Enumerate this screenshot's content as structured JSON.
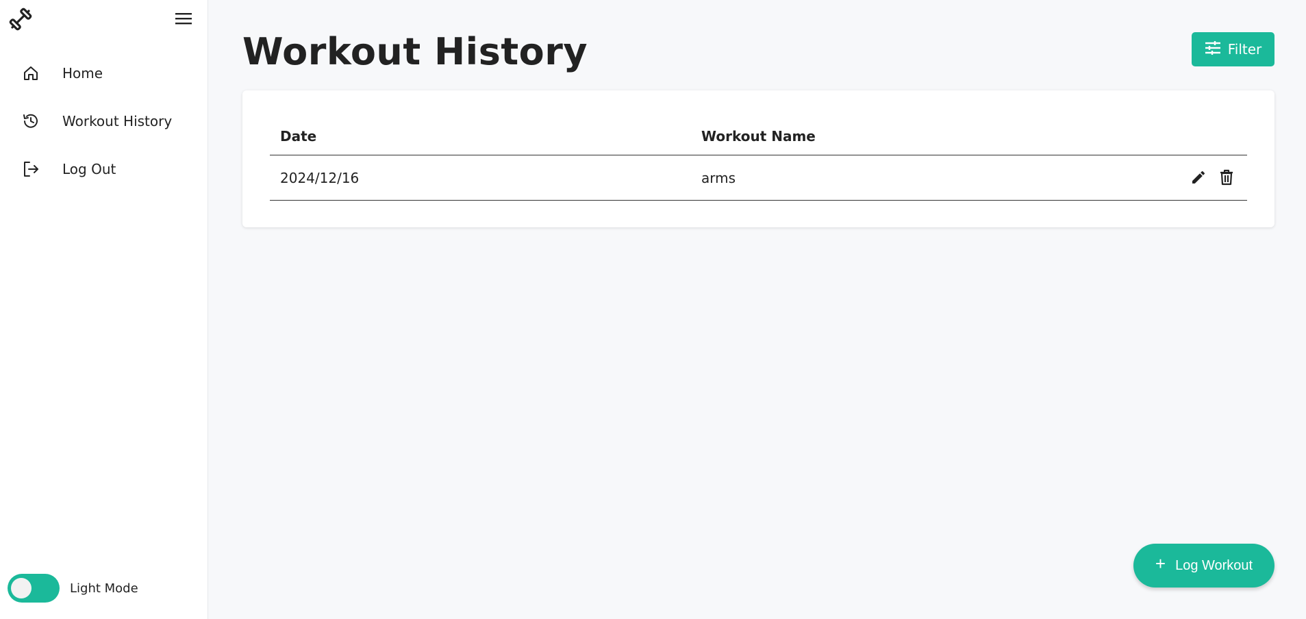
{
  "sidebar": {
    "nav": [
      {
        "label": "Home",
        "icon": "home-icon"
      },
      {
        "label": "Workout History",
        "icon": "history-icon"
      },
      {
        "label": "Log Out",
        "icon": "logout-icon"
      }
    ],
    "theme_label": "Light Mode"
  },
  "header": {
    "title": "Workout History",
    "filter_label": "Filter"
  },
  "table": {
    "columns": [
      "Date",
      "Workout Name"
    ],
    "rows": [
      {
        "date": "2024/12/16",
        "name": "arms"
      }
    ]
  },
  "fab": {
    "label": "Log Workout",
    "icon": "+"
  },
  "colors": {
    "accent": "#1bb99a",
    "background": "#f7f8fa",
    "sidebar": "#ffffff",
    "text": "#222222"
  }
}
